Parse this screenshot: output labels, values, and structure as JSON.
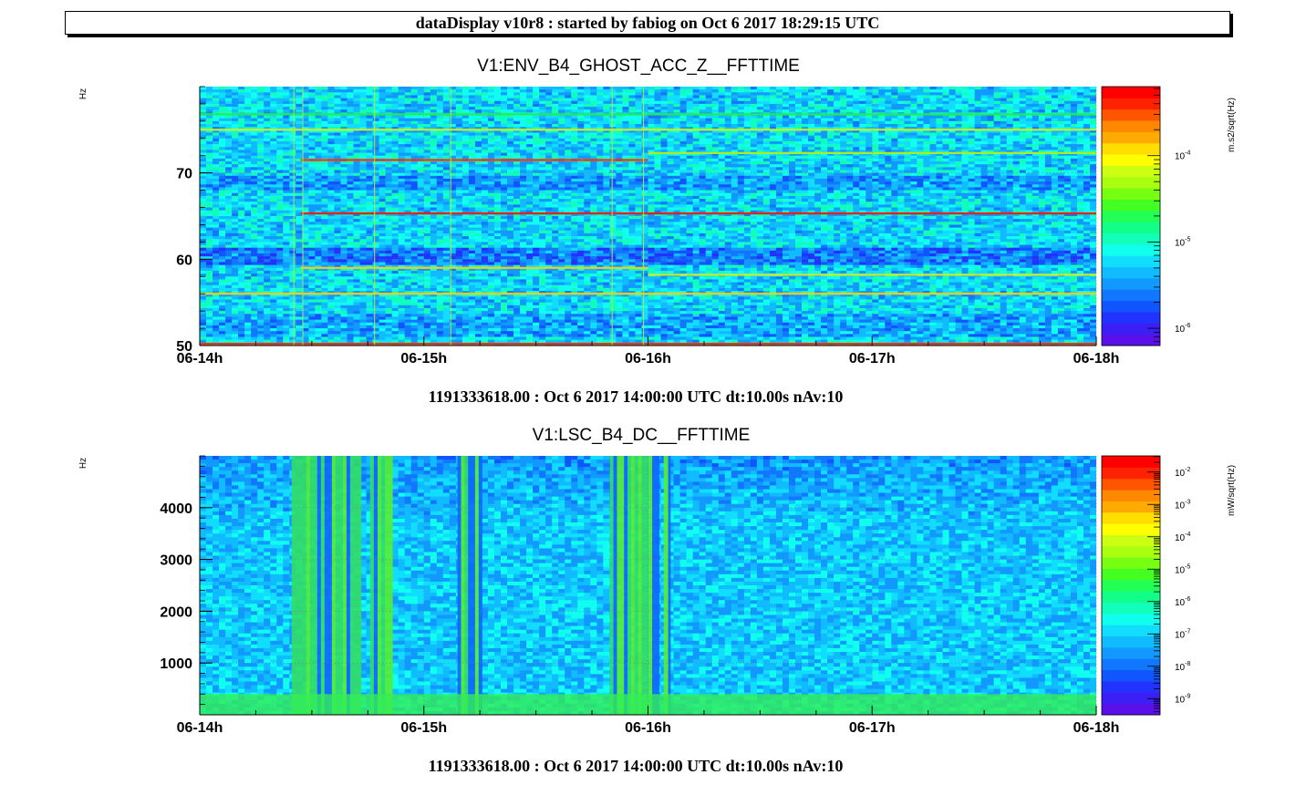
{
  "header": {
    "title": "dataDisplay v10r8 : started by fabiog on Oct  6 2017 18:29:15 UTC"
  },
  "chart_data": [
    {
      "type": "heatmap",
      "title": "V1:ENV_B4_GHOST_ACC_Z__FFTTIME",
      "ylabel": "Hz",
      "xlabel": "",
      "x_ticks": [
        "06-14h",
        "06-15h",
        "06-16h",
        "06-17h",
        "06-18h"
      ],
      "x_range": [
        0,
        4
      ],
      "y_ticks": [
        50,
        60,
        70
      ],
      "y_tick_labels": [
        "50",
        "60",
        "70"
      ],
      "ylim": [
        50,
        80
      ],
      "colorbar": {
        "unit": "m.s2/sqrt(Hz)",
        "scale": "log",
        "ticks": [
          "10^-6",
          "10^-5",
          "10^-4"
        ],
        "min_exp": -6.2,
        "max_exp": -3.2
      },
      "lines": [
        {
          "hz": 76.8,
          "t": [
            0,
            4
          ],
          "color": "#22ee44"
        },
        {
          "hz": 75.0,
          "t": [
            0,
            4
          ],
          "color": "#ccee22"
        },
        {
          "hz": 71.5,
          "t": [
            0.45,
            2.0
          ],
          "color": "#ff3300"
        },
        {
          "hz": 72.3,
          "t": [
            2.0,
            4
          ],
          "color": "#aaee22"
        },
        {
          "hz": 65.3,
          "t": [
            0.45,
            4
          ],
          "color": "#ee2200"
        },
        {
          "hz": 59.0,
          "t": [
            0.45,
            2.0
          ],
          "color": "#ffcc00"
        },
        {
          "hz": 58.2,
          "t": [
            2.0,
            4
          ],
          "color": "#ccee22"
        },
        {
          "hz": 56.0,
          "t": [
            0,
            4
          ],
          "color": "#ffcc00"
        },
        {
          "hz": 50.2,
          "t": [
            0,
            4
          ],
          "color": "#ff3300"
        }
      ],
      "footer": "1191333618.00 : Oct  6 2017 14:00:00 UTC dt:10.00s nAv:10"
    },
    {
      "type": "heatmap",
      "title": "V1:LSC_B4_DC__FFTTIME",
      "ylabel": "Hz",
      "xlabel": "",
      "x_ticks": [
        "06-14h",
        "06-15h",
        "06-16h",
        "06-17h",
        "06-18h"
      ],
      "x_range": [
        0,
        4
      ],
      "y_ticks": [
        1000,
        2000,
        3000,
        4000
      ],
      "y_tick_labels": [
        "1000",
        "2000",
        "3000",
        "4000"
      ],
      "ylim": [
        0,
        5000
      ],
      "colorbar": {
        "unit": "mW/sqrt(Hz)",
        "scale": "log",
        "ticks": [
          "10^-9",
          "10^-8",
          "10^-7",
          "10^-6",
          "10^-5",
          "10^-4",
          "10^-3",
          "10^-2"
        ],
        "min_exp": -9.5,
        "max_exp": -1.5
      },
      "bursts": [
        {
          "t": [
            0.41,
            0.72
          ],
          "level": "high"
        },
        {
          "t": [
            0.76,
            0.86
          ],
          "level": "high"
        },
        {
          "t": [
            1.15,
            1.26
          ],
          "level": "high"
        },
        {
          "t": [
            1.83,
            2.05
          ],
          "level": "high"
        },
        {
          "t": [
            2.07,
            2.1
          ],
          "level": "high"
        }
      ],
      "footer": "1191333618.00 : Oct  6 2017 14:00:00 UTC dt:10.00s nAv:10"
    }
  ]
}
